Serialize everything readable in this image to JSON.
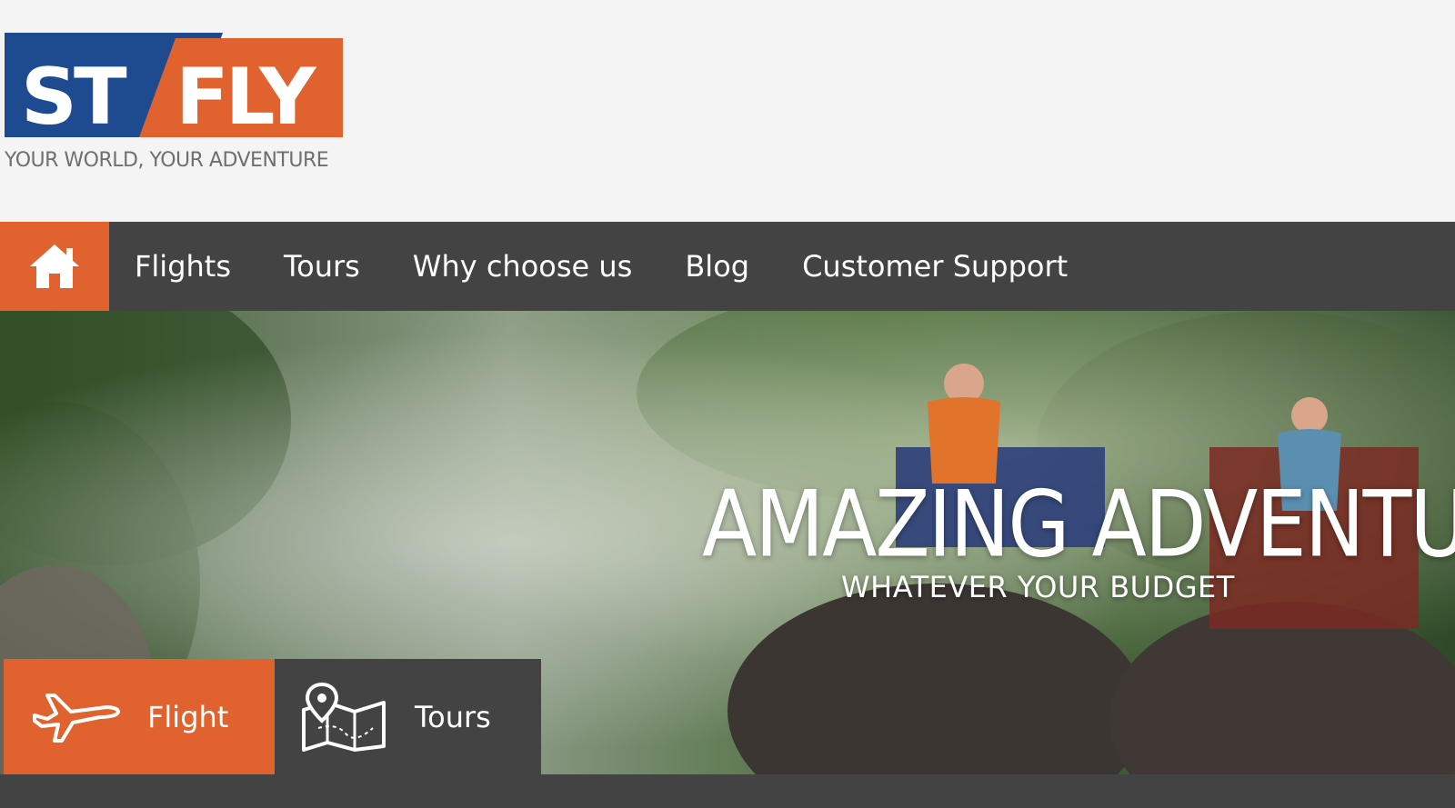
{
  "brand": {
    "logo_left": "ST",
    "logo_right": "FLY",
    "tagline": "YOUR WORLD, YOUR ADVENTURE",
    "colors": {
      "blue": "#1e4b8f",
      "orange": "#e0622f"
    }
  },
  "nav": {
    "home_icon": "home-icon",
    "items": [
      {
        "label": "Flights"
      },
      {
        "label": "Tours"
      },
      {
        "label": "Why choose us"
      },
      {
        "label": "Blog"
      },
      {
        "label": "Customer Support"
      }
    ],
    "colors": {
      "bar": "#434343",
      "active": "#e0622f"
    }
  },
  "hero": {
    "title": "AMAZING ADVENTURES",
    "subtitle": "WHATEVER YOUR BUDGET"
  },
  "search_tabs": [
    {
      "label": "Flight",
      "icon": "airplane-icon",
      "active": true
    },
    {
      "label": "Tours",
      "icon": "map-pin-icon",
      "active": false
    }
  ]
}
